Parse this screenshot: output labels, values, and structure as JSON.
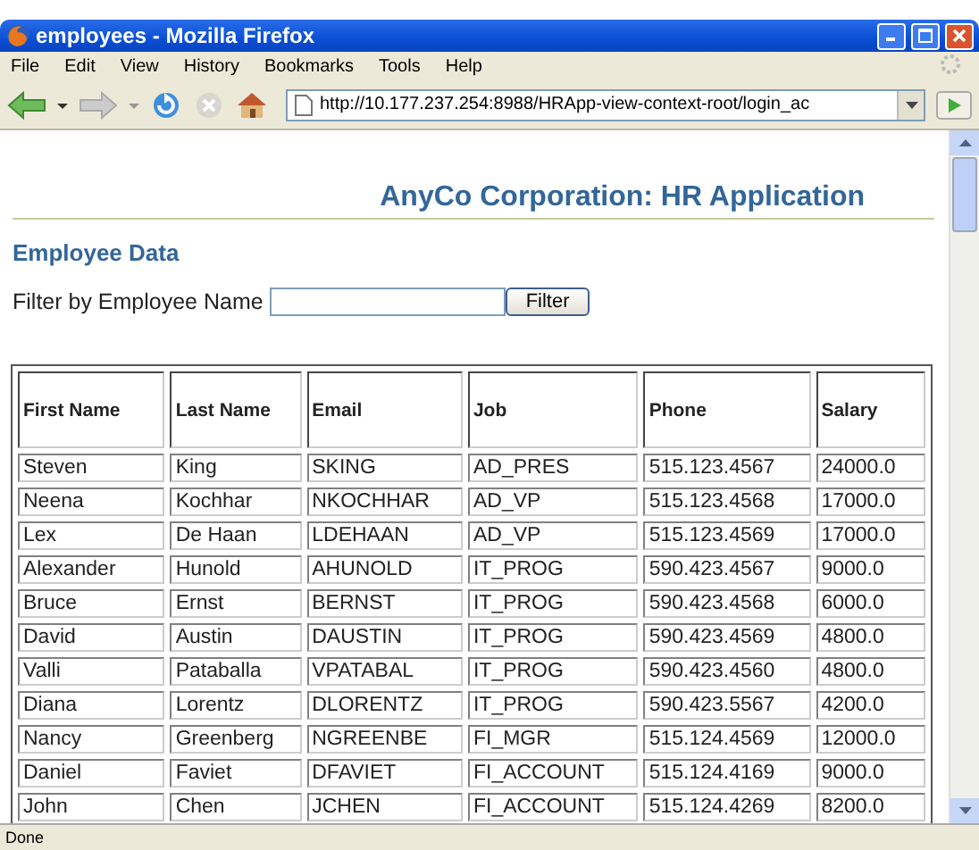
{
  "window": {
    "title": "employees - Mozilla Firefox"
  },
  "menu": [
    "File",
    "Edit",
    "View",
    "History",
    "Bookmarks",
    "Tools",
    "Help"
  ],
  "address_bar": {
    "url": "http://10.177.237.254:8988/HRApp-view-context-root/login_ac"
  },
  "page": {
    "heading": "AnyCo Corporation: HR Application",
    "section_title": "Employee Data",
    "filter_label": "Filter by Employee Name",
    "filter_button": "Filter"
  },
  "table": {
    "columns": [
      "First Name",
      "Last Name",
      "Email",
      "Job",
      "Phone",
      "Salary"
    ],
    "rows": [
      [
        "Steven",
        "King",
        "SKING",
        "AD_PRES",
        "515.123.4567",
        "24000.0"
      ],
      [
        "Neena",
        "Kochhar",
        "NKOCHHAR",
        "AD_VP",
        "515.123.4568",
        "17000.0"
      ],
      [
        "Lex",
        "De Haan",
        "LDEHAAN",
        "AD_VP",
        "515.123.4569",
        "17000.0"
      ],
      [
        "Alexander",
        "Hunold",
        "AHUNOLD",
        "IT_PROG",
        "590.423.4567",
        "9000.0"
      ],
      [
        "Bruce",
        "Ernst",
        "BERNST",
        "IT_PROG",
        "590.423.4568",
        "6000.0"
      ],
      [
        "David",
        "Austin",
        "DAUSTIN",
        "IT_PROG",
        "590.423.4569",
        "4800.0"
      ],
      [
        "Valli",
        "Pataballa",
        "VPATABAL",
        "IT_PROG",
        "590.423.4560",
        "4800.0"
      ],
      [
        "Diana",
        "Lorentz",
        "DLORENTZ",
        "IT_PROG",
        "590.423.5567",
        "4200.0"
      ],
      [
        "Nancy",
        "Greenberg",
        "NGREENBE",
        "FI_MGR",
        "515.124.4569",
        "12000.0"
      ],
      [
        "Daniel",
        "Faviet",
        "DFAVIET",
        "FI_ACCOUNT",
        "515.124.4169",
        "9000.0"
      ],
      [
        "John",
        "Chen",
        "JCHEN",
        "FI_ACCOUNT",
        "515.124.4269",
        "8200.0"
      ]
    ]
  },
  "status_bar": {
    "text": "Done"
  }
}
